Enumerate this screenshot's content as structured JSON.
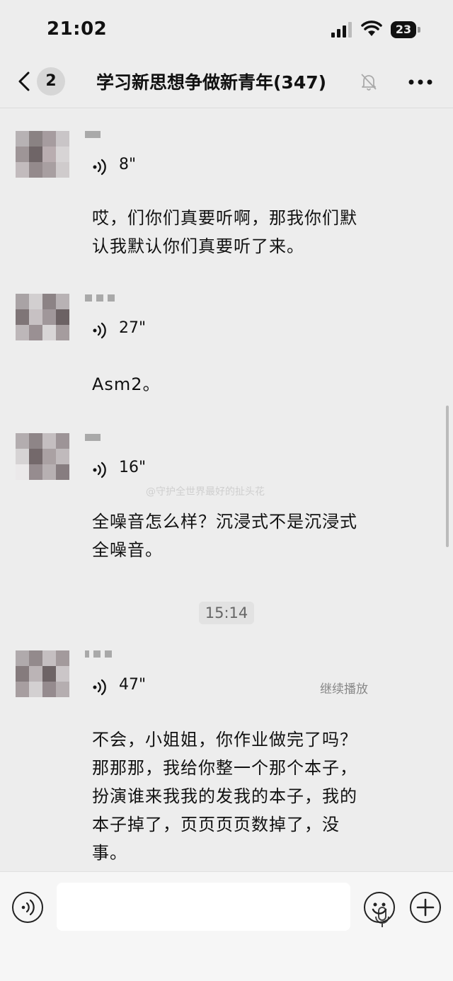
{
  "status_bar": {
    "time": "21:02",
    "battery": "23"
  },
  "nav": {
    "back_count": "2",
    "title": "学习新思想争做新青年(347)"
  },
  "messages": [
    {
      "duration": "8\"",
      "text": "哎，们你们真要听啊，那我你们默认我默认你们真要听了来。"
    },
    {
      "duration": "27\"",
      "text": "Asm2。"
    },
    {
      "duration": "16\"",
      "text": "全噪音怎么样？沉浸式不是沉浸式全噪音。"
    },
    {
      "duration": "47\"",
      "text": "不会，小姐姐，你作业做完了吗？那那那，我给你整一个那个本子，扮演谁来我我的发我的本子，我的本子掉了，页页页页数掉了，没事。",
      "action": "继续播放"
    }
  ],
  "timestamp": "15:14",
  "watermark": "@守护全世界最好的扯头花",
  "icons": {
    "back": "chevron-left-icon",
    "mute": "bell-slash-icon",
    "more": "more-icon",
    "voice": "voice-wave-icon",
    "mic": "microphone-icon",
    "emoji": "emoji-icon",
    "add": "plus-icon"
  }
}
